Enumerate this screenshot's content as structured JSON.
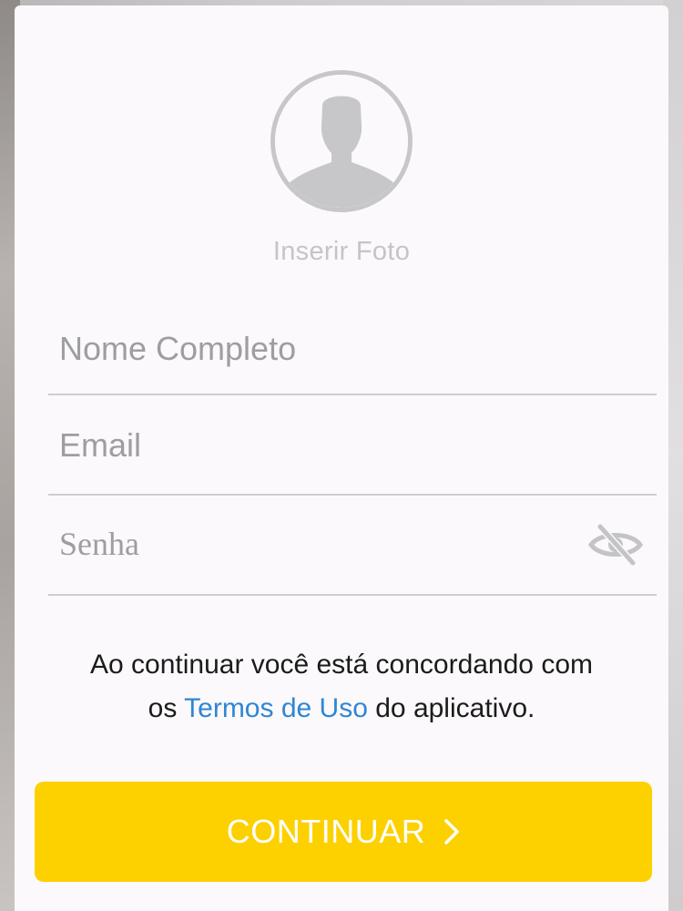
{
  "profile": {
    "photo_label": "Inserir Foto",
    "avatar_icon": "user-silhouette-icon"
  },
  "form": {
    "name_placeholder": "Nome Completo",
    "name_value": "",
    "email_placeholder": "Email",
    "email_value": "",
    "password_placeholder": "Senha",
    "password_value": "",
    "visibility_icon": "eye-off-icon"
  },
  "terms": {
    "prefix": "Ao continuar você está concordando com",
    "os": "os",
    "link_text": "Termos de Uso",
    "suffix": "do aplicativo."
  },
  "actions": {
    "continue_label": "CONTINUAR",
    "continue_icon": "chevron-right-icon"
  },
  "colors": {
    "accent": "#fdd000",
    "link": "#2f86d4",
    "placeholder": "#9e9da1"
  }
}
